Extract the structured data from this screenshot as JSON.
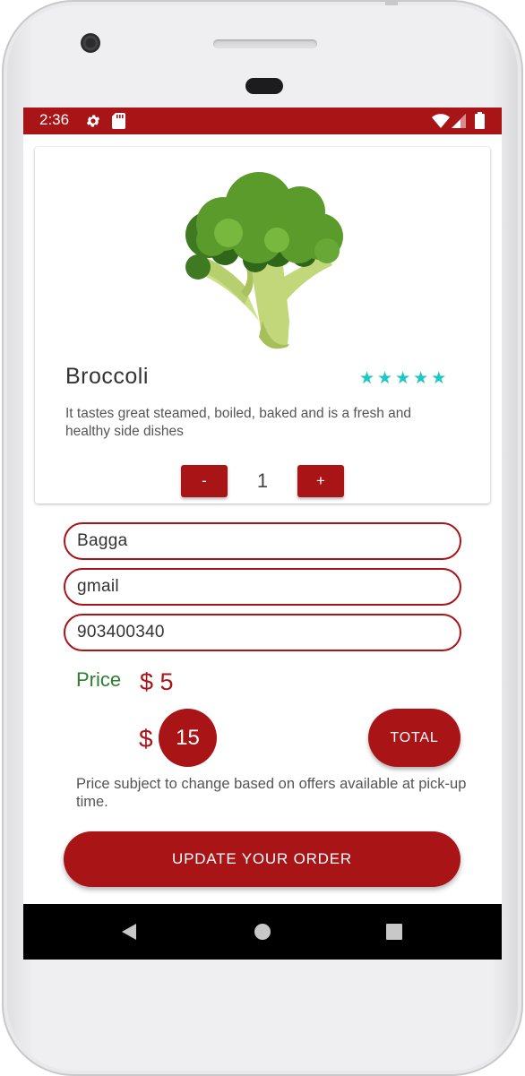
{
  "status_bar": {
    "time": "2:36",
    "icons": [
      "gear-icon",
      "sd-card-icon",
      "wifi-icon",
      "signal-icon",
      "battery-icon"
    ],
    "color": "#a91417"
  },
  "product": {
    "image": "broccoli-image",
    "title": "Broccoli",
    "rating": 5,
    "rating_max": 5,
    "description": "It tastes great steamed, boiled, baked and is a fresh and healthy side dishes",
    "quantity": {
      "decrement_label": "-",
      "value": "1",
      "increment_label": "+"
    }
  },
  "form": {
    "name_value": "Bagga",
    "email_value": "gmail",
    "phone_value": "903400340"
  },
  "pricing": {
    "price_label": "Price",
    "price_value": "$ 5",
    "total_currency": "$",
    "total_value": "15",
    "total_button_label": "TOTAL",
    "note": "Price subject to change based on offers available at pick-up time."
  },
  "actions": {
    "update_label": "UPDATE YOUR ORDER"
  },
  "nav_bar": {
    "icons": [
      "back-icon",
      "home-icon",
      "recents-icon"
    ]
  },
  "colors": {
    "accent": "#a91417",
    "price_label": "#2e7d32",
    "stars": "#1ec7c4"
  }
}
